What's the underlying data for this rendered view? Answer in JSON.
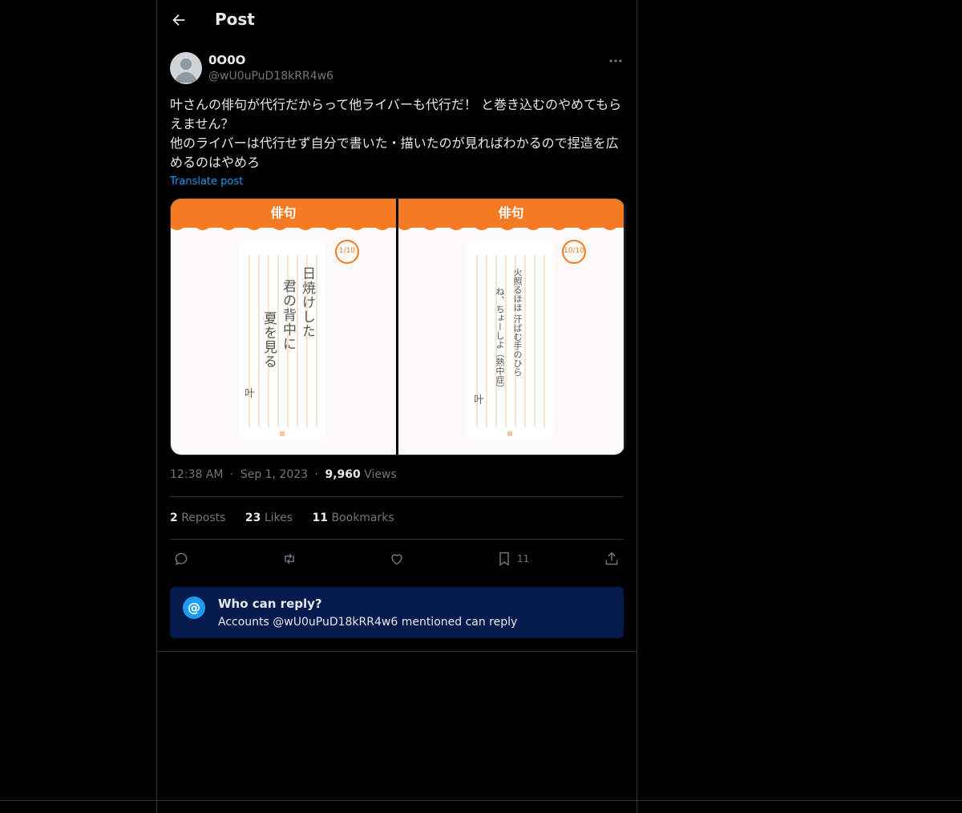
{
  "header": {
    "title": "Post",
    "back_icon": "arrow-left-icon"
  },
  "author": {
    "name": "0O0O",
    "handle": "@wU0uPuD18kRR4w6",
    "avatar_icon": "default-avatar-icon"
  },
  "post": {
    "text": "叶さんの俳句が代行だからって他ライバーも代行だ！ と巻き込むのやめてもらえません？\n他のライバーは代行せず自分で書いた・描いたのが見ればわかるので捏造を広めるのはやめろ",
    "translate_label": "Translate post"
  },
  "media": {
    "left": {
      "header": "俳句",
      "counter": "1/10",
      "lines": [
        "日焼けした",
        "君の背中に",
        "夏を見る"
      ],
      "signature": "叶"
    },
    "right": {
      "header": "俳句",
      "counter": "10/10",
      "lines": [
        "火照るほほ 汗ばむ手のひら",
        "ね、ちょーしよ（熱中症）"
      ],
      "signature": "叶"
    }
  },
  "meta": {
    "time": "12:38 AM",
    "date": "Sep 1, 2023",
    "views_count": "9,960",
    "views_label": "Views",
    "sep": "·"
  },
  "stats": {
    "reposts_count": "2",
    "reposts_label": "Reposts",
    "likes_count": "23",
    "likes_label": "Likes",
    "bookmarks_count": "11",
    "bookmarks_label": "Bookmarks"
  },
  "actions": {
    "bookmark_count": "11"
  },
  "reply_restriction": {
    "icon_text": "@",
    "title": "Who can reply?",
    "subtitle": "Accounts @wU0uPuD18kRR4w6 mentioned can reply"
  },
  "colors": {
    "accent": "#1d9bf0",
    "orange": "#f47a24",
    "reply_bg": "#061b4d",
    "muted": "#71767b"
  }
}
